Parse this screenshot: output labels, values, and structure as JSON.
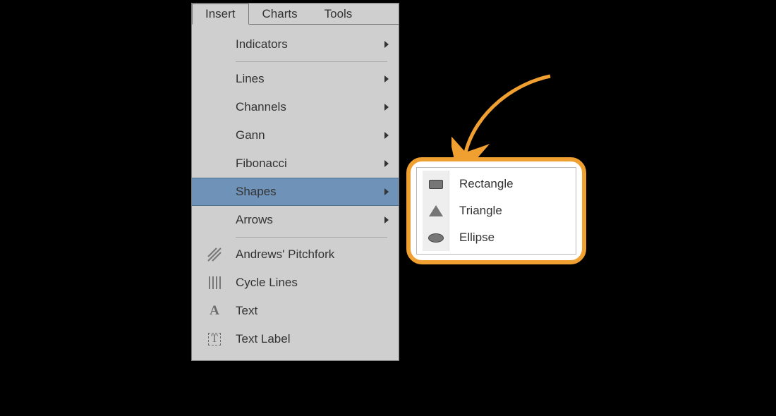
{
  "menubar": {
    "tabs": [
      {
        "label": "Insert",
        "active": true
      },
      {
        "label": "Charts",
        "active": false
      },
      {
        "label": "Tools",
        "active": false
      }
    ]
  },
  "menu": {
    "group1": [
      {
        "label": "Indicators",
        "has_submenu": true
      }
    ],
    "group2": [
      {
        "label": "Lines",
        "has_submenu": true
      },
      {
        "label": "Channels",
        "has_submenu": true
      },
      {
        "label": "Gann",
        "has_submenu": true
      },
      {
        "label": "Fibonacci",
        "has_submenu": true
      },
      {
        "label": "Shapes",
        "has_submenu": true,
        "highlighted": true
      },
      {
        "label": "Arrows",
        "has_submenu": true
      }
    ],
    "group3": [
      {
        "label": "Andrews' Pitchfork",
        "icon": "pitchfork-icon"
      },
      {
        "label": "Cycle Lines",
        "icon": "cycle-lines-icon"
      },
      {
        "label": "Text",
        "icon": "text-icon"
      },
      {
        "label": "Text Label",
        "icon": "text-label-icon"
      }
    ]
  },
  "submenu": {
    "shapes": [
      {
        "label": "Rectangle",
        "icon": "rectangle-icon"
      },
      {
        "label": "Triangle",
        "icon": "triangle-icon"
      },
      {
        "label": "Ellipse",
        "icon": "ellipse-icon"
      }
    ]
  },
  "highlight_color": "#f0a030"
}
